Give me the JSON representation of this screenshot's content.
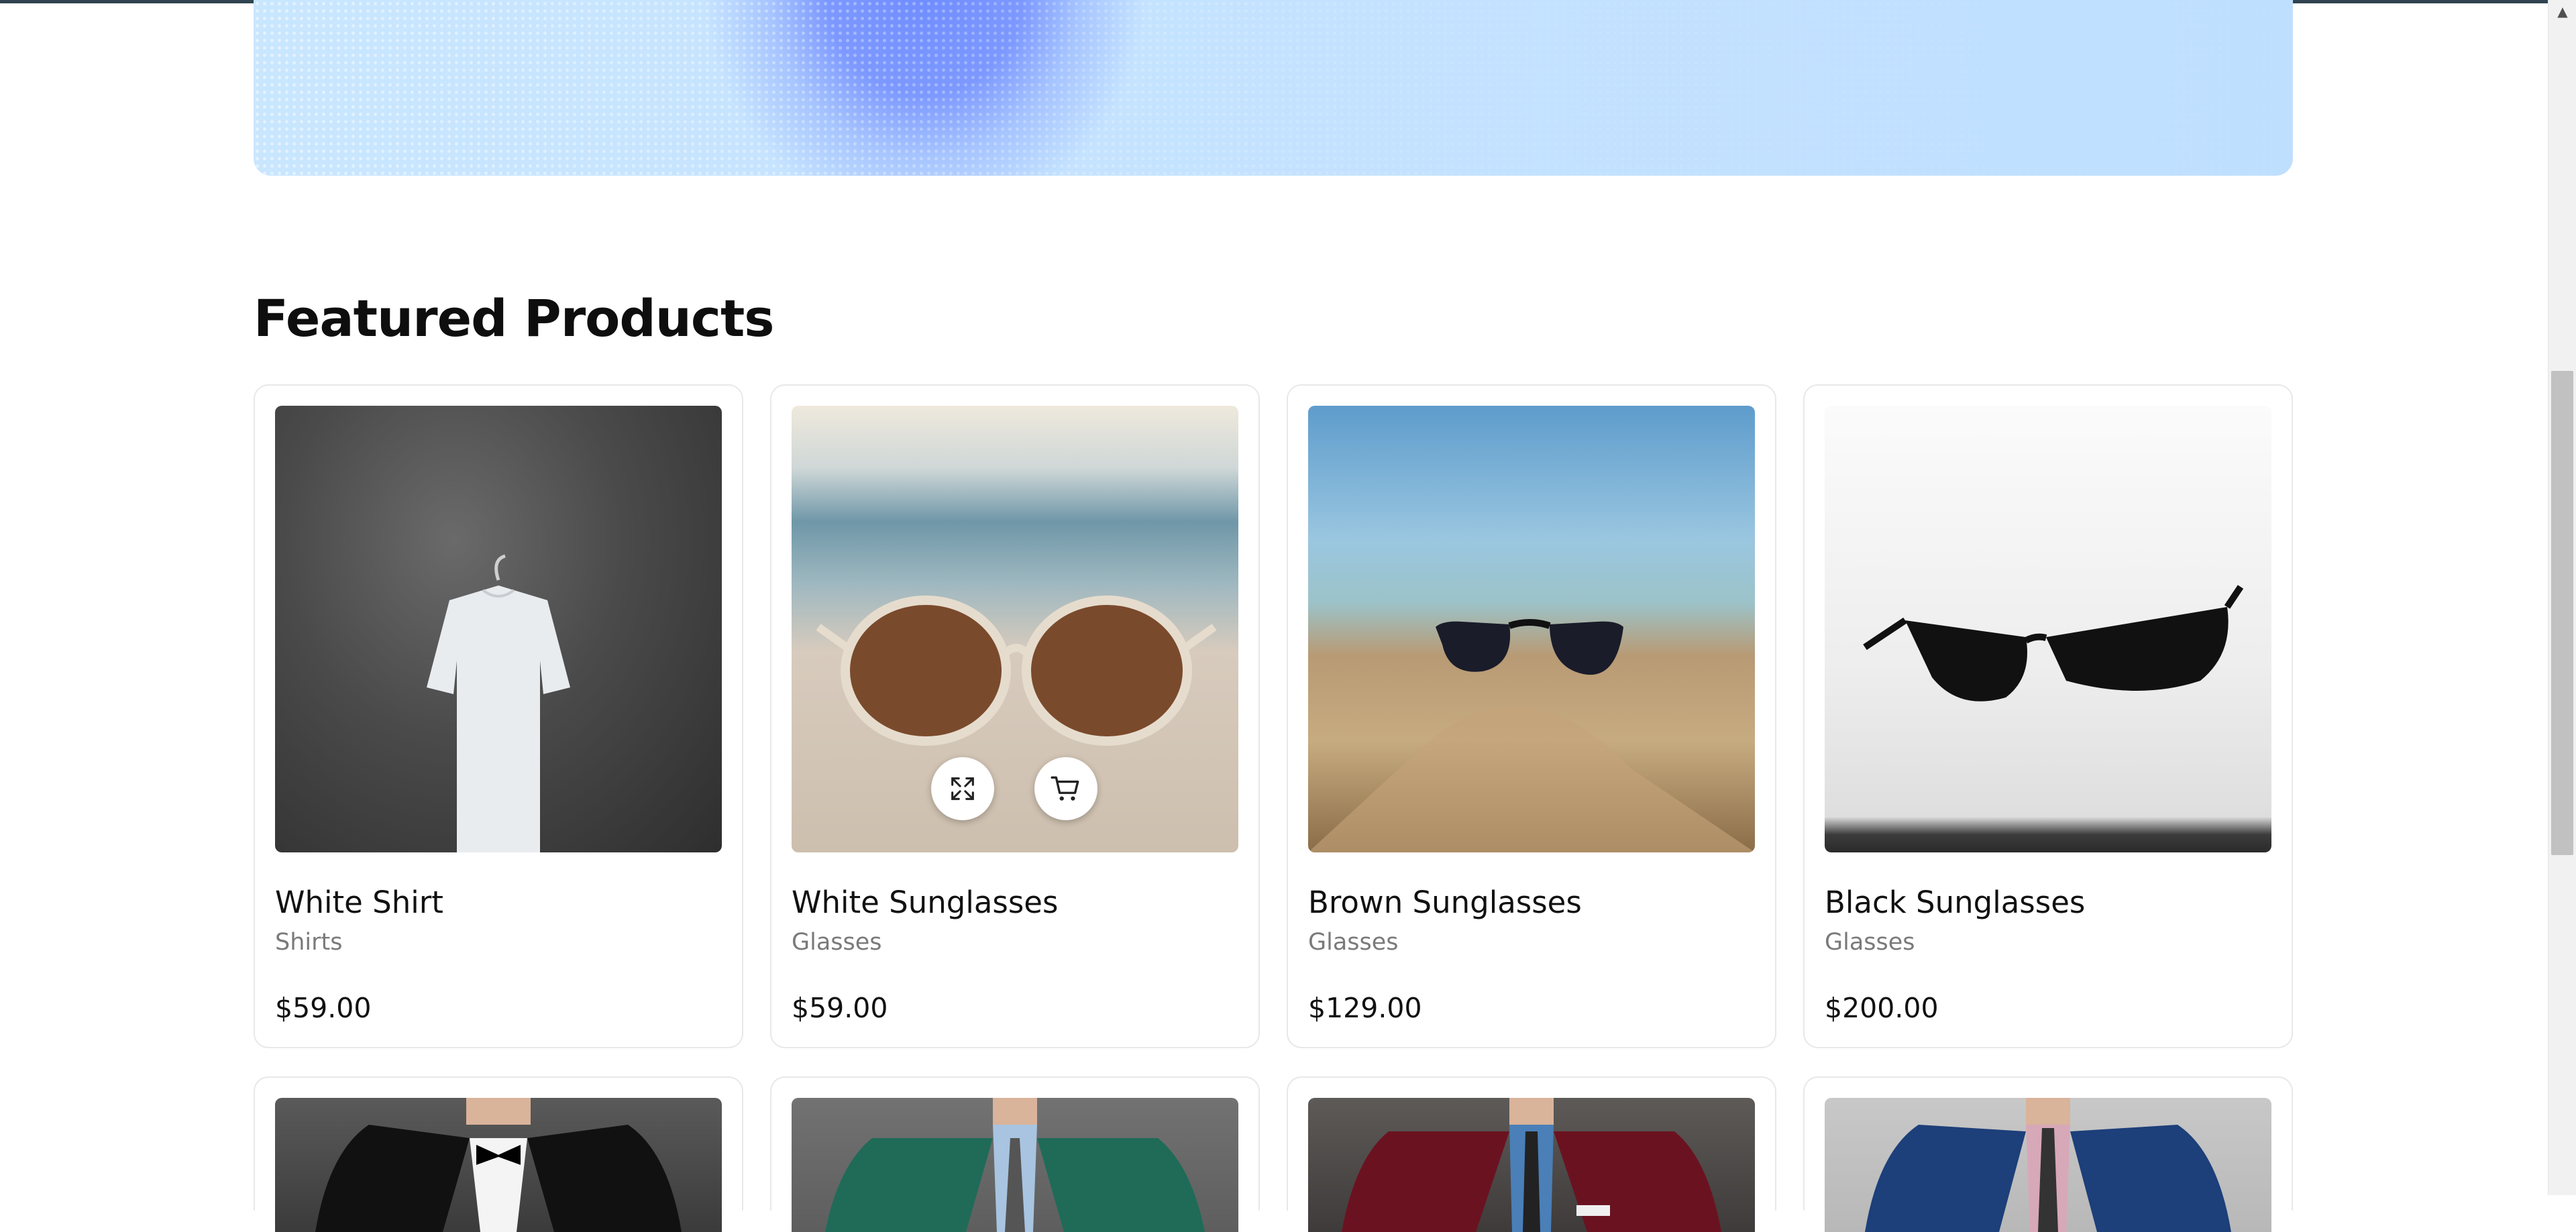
{
  "section": {
    "title": "Featured Products"
  },
  "products": [
    {
      "name": "White Shirt",
      "category": "Shirts",
      "price": "$59.00"
    },
    {
      "name": "White Sunglasses",
      "category": "Glasses",
      "price": "$59.00"
    },
    {
      "name": "Brown Sunglasses",
      "category": "Glasses",
      "price": "$129.00"
    },
    {
      "name": "Black Sunglasses",
      "category": "Glasses",
      "price": "$200.00"
    }
  ],
  "hover_actions": {
    "icons": [
      "expand-icon",
      "cart-icon"
    ]
  },
  "colors": {
    "banner_light": "#c9e6ff",
    "banner_accent": "#7d99ff",
    "card_border": "#e8e8e8",
    "muted_text": "#7a7a7a"
  }
}
